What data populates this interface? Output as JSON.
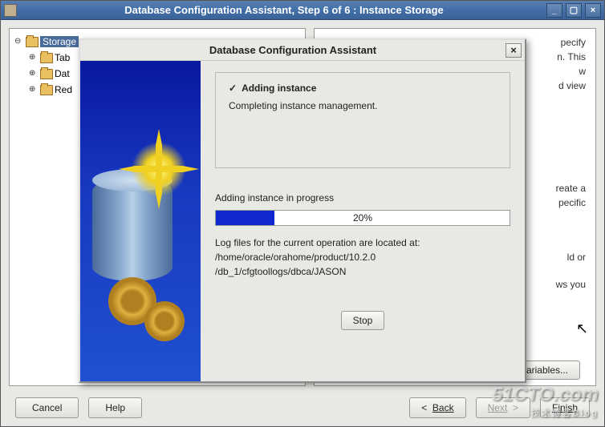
{
  "window": {
    "title": "Database Configuration Assistant, Step 6 of 6 : Instance Storage",
    "minimize": "_",
    "maximize": "▢",
    "close": "×"
  },
  "tree": {
    "root": "Storage",
    "items": [
      "Tab",
      "Dat",
      "Red"
    ]
  },
  "right_panel": {
    "frag1": "pecify",
    "frag2": "n. This",
    "frag3": "w",
    "frag4": "d view",
    "frag5": "reate a",
    "frag6": "pecific",
    "frag7": "ld or",
    "frag8": "ws you"
  },
  "file_vars_btn": "ariables...",
  "bottom": {
    "cancel": "Cancel",
    "help": "Help",
    "back": "Back",
    "next": "Next",
    "finish": "Finish"
  },
  "modal": {
    "title": "Database Configuration Assistant",
    "close": "×",
    "status_heading": "Adding instance",
    "status_detail": "Completing instance management.",
    "progress_label": "Adding instance in progress",
    "progress_pct_text": "20%",
    "progress_pct": 20,
    "log_line1": "Log files for the current operation are located at:",
    "log_line2": "/home/oracle/orahome/product/10.2.0",
    "log_line3": "/db_1/cfgtoollogs/dbca/JASON",
    "stop": "Stop"
  },
  "watermark": {
    "brand": "51CTO.com",
    "sub": "技术博客Blog"
  }
}
